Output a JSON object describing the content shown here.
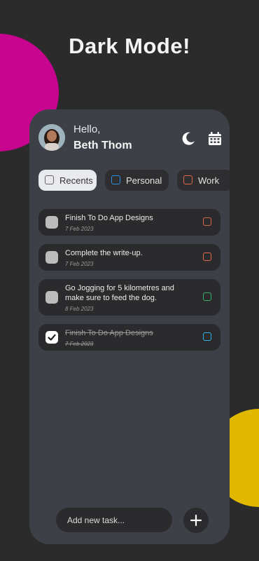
{
  "header": {
    "title": "Dark Mode!"
  },
  "user": {
    "greeting": "Hello,",
    "name": "Beth Thom"
  },
  "icons": {
    "theme_toggle": "moon-icon",
    "calendar": "calendar-icon",
    "add": "plus-icon"
  },
  "colors": {
    "background": "#2b2b2b",
    "card": "#3d4046",
    "accent_magenta": "#c7058f",
    "accent_yellow": "#e0b800",
    "personal": "#2f8fe4",
    "work": "#e3684b",
    "green": "#2eb56b",
    "blue": "#2bb6e6"
  },
  "filters": [
    {
      "label": "Recents",
      "selected": true
    },
    {
      "label": "Personal",
      "selected": false
    },
    {
      "label": "Work",
      "selected": false
    }
  ],
  "tasks": [
    {
      "title": "Finish To Do App Designs",
      "date": "7 Feb 2023",
      "done": false,
      "tag_color": "#e3684b"
    },
    {
      "title": "Complete the write-up.",
      "date": "7 Feb 2023",
      "done": false,
      "tag_color": "#e3684b"
    },
    {
      "title": "Go Jogging for 5 kilometres and make sure to feed the dog.",
      "date": "8 Feb 2023",
      "done": false,
      "tag_color": "#2eb56b"
    },
    {
      "title": "Finish To Do App Designs",
      "date": "7 Feb 2023",
      "done": true,
      "tag_color": "#2bb6e6"
    }
  ],
  "composer": {
    "placeholder": "Add new task..."
  }
}
